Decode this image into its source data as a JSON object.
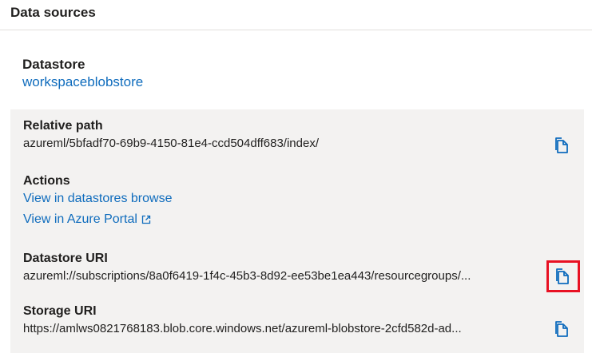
{
  "section": {
    "title": "Data sources"
  },
  "datastore": {
    "label": "Datastore",
    "value": "workspaceblobstore"
  },
  "relative_path": {
    "label": "Relative path",
    "value": "azureml/5bfadf70-69b9-4150-81e4-ccd504dff683/index/"
  },
  "actions": {
    "label": "Actions",
    "browse_link": "View in datastores browse",
    "portal_link": "View in Azure Portal"
  },
  "datastore_uri": {
    "label": "Datastore URI",
    "value": "azureml://subscriptions/8a0f6419-1f4c-45b3-8d92-ee53be1ea443/resourcegroups/..."
  },
  "storage_uri": {
    "label": "Storage URI",
    "value": "https://amlws0821768183.blob.core.windows.net/azureml-blobstore-2cfd582d-ad..."
  },
  "icons": {
    "copy": "copy-icon",
    "external": "external-link-icon"
  },
  "colors": {
    "link": "#0f6cbd",
    "panel": "#f3f2f1",
    "highlight": "#e81123"
  }
}
